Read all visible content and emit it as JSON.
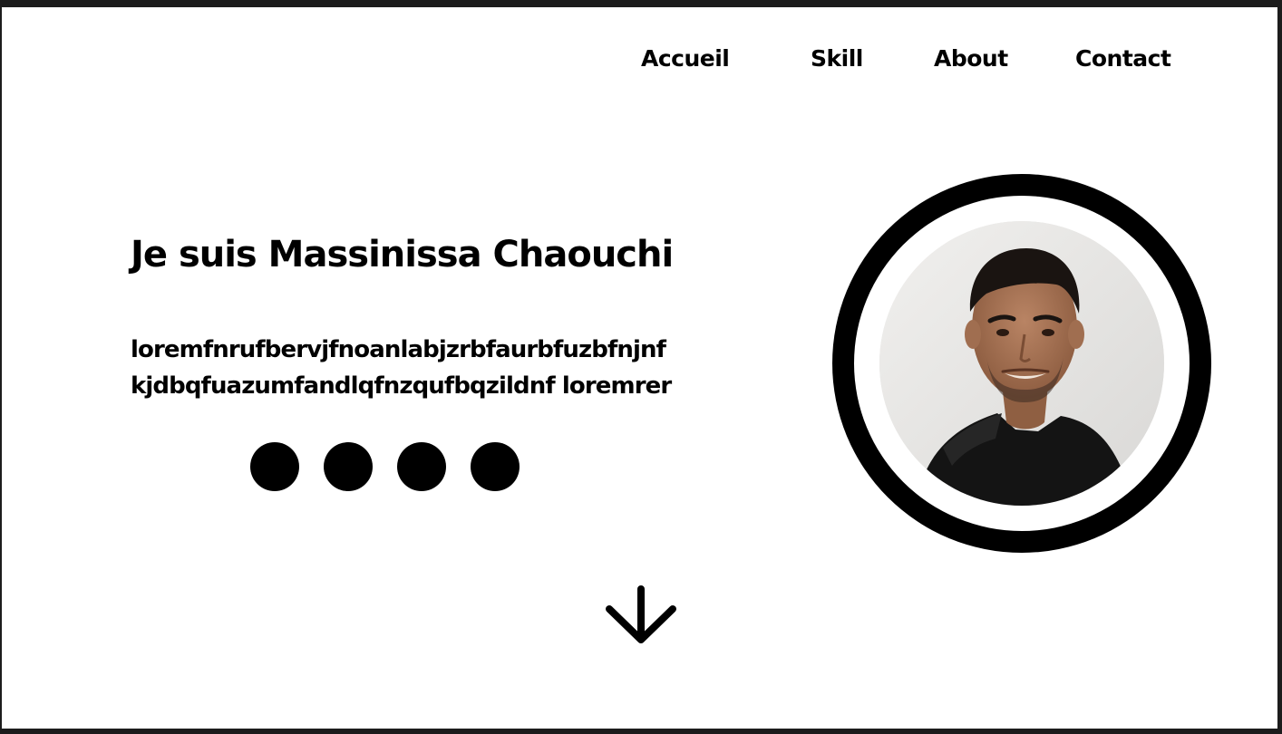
{
  "nav": {
    "items": [
      {
        "label": "Accueil"
      },
      {
        "label": "Skill"
      },
      {
        "label": "About"
      },
      {
        "label": "Contact"
      }
    ]
  },
  "hero": {
    "title": "Je suis Massinissa Chaouchi",
    "description_lines": [
      "loremfnrufbervjfnoanlabjzrbfaurbfuzbfnjnf",
      "kjdbqfuazumfandlqfnzqufbqzildnf loremrer"
    ],
    "social_icons": [
      "social-icon",
      "social-icon",
      "social-icon",
      "social-icon"
    ],
    "scroll_icon": "arrow-down-icon"
  },
  "colors": {
    "background": "#ffffff",
    "text": "#000000",
    "frame": "#1c1c1c"
  }
}
